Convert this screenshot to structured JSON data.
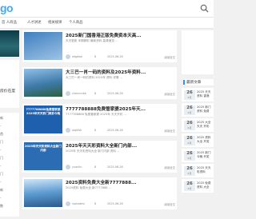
{
  "header": {
    "logo": "go",
    "search_icon": "search-icon"
  },
  "nav": {
    "items": [
      "首 人商品",
      "人才讲述",
      "相关规律",
      "个人商品"
    ]
  },
  "left": {
    "panel_text": "房价在度",
    "list": [
      "新",
      "-",
      "首",
      "门",
      "-",
      "门",
      "-",
      "门",
      "-",
      "新",
      "-",
      "数"
    ]
  },
  "posts": [
    {
      "title": "2025新门国香港正版免费资本天高...",
      "excerpt": "天天更新 本期精彩 最新资料 高清速览 ...",
      "author": "wfgdwk",
      "views": "8",
      "date": "2025-06-26",
      "readmore": "阅读全文",
      "thumb": "",
      "thumb_color": "#3d7ec0"
    },
    {
      "title": "大三巴一肖一码的资料及2025年资料...",
      "excerpt": "大三巴一肖一码的资料 2025年 资料 详情 ...",
      "author": "chennmkb",
      "views": "8",
      "date": "2025-06-26",
      "readmore": "阅读全文",
      "thumb": "",
      "thumb_color": "#4f8fb8"
    },
    {
      "title": "7777788888免费管家婆2025年天...",
      "excerpt": "7777788888 免费管家婆 2025年 天天开彩 ...",
      "author": "aiqkfsh",
      "views": "8",
      "date": "2025-06-26",
      "readmore": "阅读全文",
      "thumb": "7777788888免费管家婆2025年天天彩门奥彩今晚",
      "thumb_color": "#1e5fae"
    },
    {
      "title": "2025年天天彩资料大全新门内部...",
      "excerpt": "2025年 天天彩资料大全 新门内部 资料 ...",
      "author": "yuanlin",
      "views": "8",
      "date": "2025-06-26",
      "readmore": "阅读全文",
      "thumb": "2025年天天彩资料大全新门内部",
      "thumb_color": "#2b6cb3"
    },
    {
      "title": "2025资料免费大全新7777888...",
      "excerpt": "2025资料 免费大全 新7777888 ...",
      "author": "rsoksdmc",
      "views": "8",
      "date": "2025-06-26",
      "readmore": "阅读全文",
      "thumb": "",
      "thumb_color": "#5b9ad0"
    }
  ],
  "sidebar": {
    "title": "最新文章",
    "items": [
      {
        "day": "26",
        "month": "6月",
        "text": "2025 天天 资料 香港"
      },
      {
        "day": "26",
        "month": "6月",
        "text": "2025 新门 资料 免费"
      },
      {
        "day": "26",
        "month": "6月",
        "text": "2025 大全 天天 开彩"
      },
      {
        "day": "26",
        "month": "6月",
        "text": "2025 资料 大全 开奖"
      },
      {
        "day": "26",
        "month": "6月",
        "text": "2025 新门 今晚 开奖"
      },
      {
        "day": "26",
        "month": "6月",
        "text": "2025 天天 彩资料"
      },
      {
        "day": "26",
        "month": "6月",
        "text": "2025 免费 资料 大全"
      }
    ]
  },
  "colors": {
    "accent": "#3a8ee6",
    "logo": "#4aa8e8"
  }
}
